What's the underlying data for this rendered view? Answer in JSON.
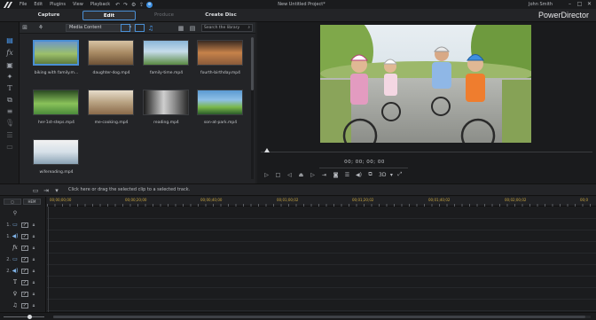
{
  "menubar": {
    "menus": [
      "File",
      "Edit",
      "Plugins",
      "View",
      "Playback"
    ],
    "project_title": "New Untitled Project*",
    "user_name": "John Smith"
  },
  "modes": {
    "capture": "Capture",
    "edit": "Edit",
    "produce": "Produce",
    "create_disc": "Create Disc"
  },
  "brand": "PowerDirector",
  "library": {
    "media_filter": "Media Content",
    "search_placeholder": "Search the library",
    "clips": [
      {
        "label": "biking with family.m...",
        "selected": true,
        "colors": [
          "#5f8bb8",
          "#b8c76a",
          "#6a7d4a"
        ]
      },
      {
        "label": "daughter-dog.mp4",
        "selected": false,
        "colors": [
          "#b8a58a",
          "#8a6a4a",
          "#d6c3a4"
        ]
      },
      {
        "label": "family-time.mp4",
        "selected": false,
        "colors": [
          "#6a9ac2",
          "#b8d2e6",
          "#4a7a3a"
        ]
      },
      {
        "label": "fourth-birthday.mp4",
        "selected": false,
        "colors": [
          "#8a5a3a",
          "#c6824a",
          "#3a2a22"
        ]
      },
      {
        "label": "her-1st-steps.mp4",
        "selected": false,
        "colors": [
          "#4a8a3a",
          "#8ac25a",
          "#2a4a22"
        ]
      },
      {
        "label": "me-cooking.mp4",
        "selected": false,
        "colors": [
          "#d2c2a8",
          "#8a6a4a",
          "#e6dccb"
        ]
      },
      {
        "label": "reading.mp4",
        "selected": false,
        "colors": [
          "#2a2a2a",
          "#c8c8c8",
          "#6a6a6a"
        ]
      },
      {
        "label": "son-at-park.mp4",
        "selected": false,
        "colors": [
          "#5a9ad2",
          "#7ab84a",
          "#2a5a2a"
        ]
      },
      {
        "label": "wifereading.mp4",
        "selected": false,
        "colors": [
          "#e6e6e6",
          "#c8d6e2",
          "#8aa2b4"
        ]
      }
    ]
  },
  "preview": {
    "timecode": "00; 00; 00; 00",
    "stereo_label": "3D"
  },
  "timeline": {
    "hint": "Click here or drag the selected clip to a selected track.",
    "toggle_a": "",
    "toggle_b": "HEM",
    "ticks": [
      "00;00;00;00",
      "00;00;20;00",
      "00;00;40;00",
      "00;01;00;02",
      "00;01;20;02",
      "00;01;40;02",
      "00;02;00;02",
      "00;0"
    ],
    "tracks": [
      {
        "num": "",
        "icon": "marker"
      },
      {
        "num": "1.",
        "icon": "video"
      },
      {
        "num": "1.",
        "icon": "audio"
      },
      {
        "num": "",
        "icon": "fx"
      },
      {
        "num": "2.",
        "icon": "video"
      },
      {
        "num": "2.",
        "icon": "audio"
      },
      {
        "num": "",
        "icon": "title"
      },
      {
        "num": "",
        "icon": "voice"
      },
      {
        "num": "",
        "icon": "music"
      }
    ]
  }
}
